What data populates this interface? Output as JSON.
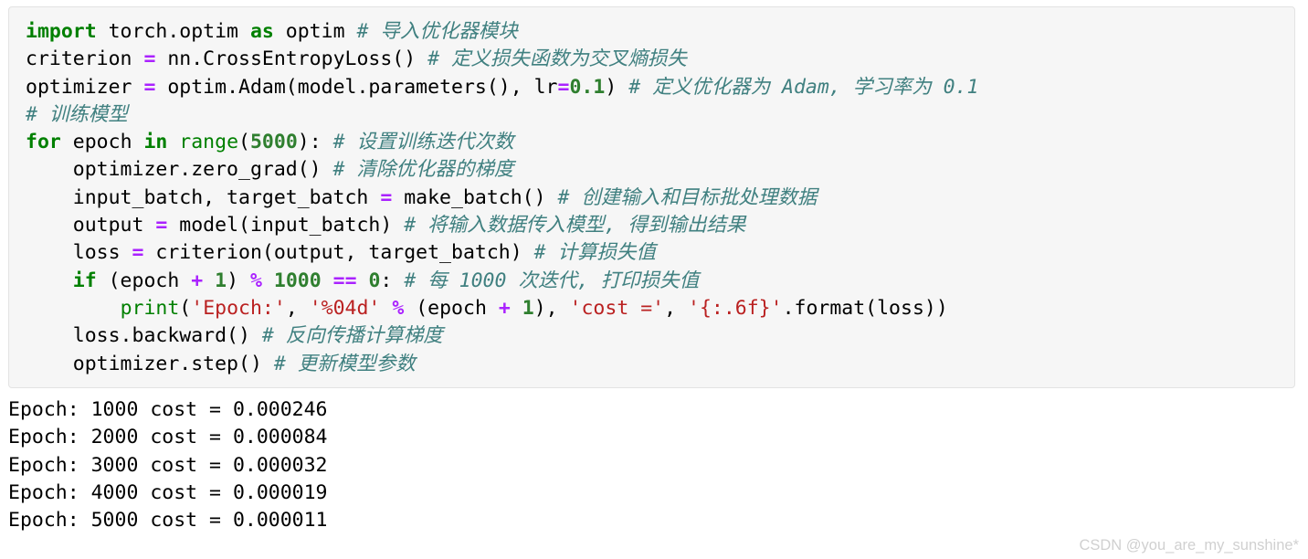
{
  "code_block": {
    "language": "python",
    "background_color": "#f6f6f6",
    "border_color": "#e3e3e3",
    "syntax_colors": {
      "keyword": "#008000",
      "builtin": "#008000",
      "number": "#2f7f2f",
      "operator": "#aa22ff",
      "string": "#ba2121",
      "comment": "#408080",
      "text": "#000000"
    },
    "lines": [
      {
        "id": "line-1",
        "tokens": [
          {
            "t": "import",
            "c": "kw"
          },
          {
            "t": " torch.optim ",
            "c": "txt"
          },
          {
            "t": "as",
            "c": "kw"
          },
          {
            "t": " optim ",
            "c": "txt"
          },
          {
            "t": "# 导入优化器模块",
            "c": "cmt"
          }
        ]
      },
      {
        "id": "line-2",
        "tokens": [
          {
            "t": "criterion ",
            "c": "txt"
          },
          {
            "t": "=",
            "c": "op"
          },
          {
            "t": " nn.CrossEntropyLoss() ",
            "c": "txt"
          },
          {
            "t": "# 定义损失函数为交叉熵损失",
            "c": "cmt"
          }
        ]
      },
      {
        "id": "line-3",
        "tokens": [
          {
            "t": "optimizer ",
            "c": "txt"
          },
          {
            "t": "=",
            "c": "op"
          },
          {
            "t": " optim.Adam(model.parameters(), lr",
            "c": "txt"
          },
          {
            "t": "=",
            "c": "op"
          },
          {
            "t": "0.1",
            "c": "num"
          },
          {
            "t": ") ",
            "c": "txt"
          },
          {
            "t": "# 定义优化器为 Adam, 学习率为 0.1",
            "c": "cmt"
          }
        ]
      },
      {
        "id": "line-4",
        "tokens": [
          {
            "t": "# 训练模型",
            "c": "cmt"
          }
        ]
      },
      {
        "id": "line-5",
        "tokens": [
          {
            "t": "for",
            "c": "kw"
          },
          {
            "t": " epoch ",
            "c": "txt"
          },
          {
            "t": "in",
            "c": "kw"
          },
          {
            "t": " ",
            "c": "txt"
          },
          {
            "t": "range",
            "c": "bi"
          },
          {
            "t": "(",
            "c": "txt"
          },
          {
            "t": "5000",
            "c": "num"
          },
          {
            "t": "): ",
            "c": "txt"
          },
          {
            "t": "# 设置训练迭代次数",
            "c": "cmt"
          }
        ]
      },
      {
        "id": "line-6",
        "tokens": [
          {
            "t": "    optimizer.zero_grad() ",
            "c": "txt"
          },
          {
            "t": "# 清除优化器的梯度",
            "c": "cmt"
          }
        ]
      },
      {
        "id": "line-7",
        "tokens": [
          {
            "t": "    input_batch, target_batch ",
            "c": "txt"
          },
          {
            "t": "=",
            "c": "op"
          },
          {
            "t": " make_batch() ",
            "c": "txt"
          },
          {
            "t": "# 创建输入和目标批处理数据",
            "c": "cmt"
          }
        ]
      },
      {
        "id": "line-8",
        "tokens": [
          {
            "t": "    output ",
            "c": "txt"
          },
          {
            "t": "=",
            "c": "op"
          },
          {
            "t": " model(input_batch) ",
            "c": "txt"
          },
          {
            "t": "# 将输入数据传入模型, 得到输出结果",
            "c": "cmt"
          }
        ]
      },
      {
        "id": "line-9",
        "tokens": [
          {
            "t": "    loss ",
            "c": "txt"
          },
          {
            "t": "=",
            "c": "op"
          },
          {
            "t": " criterion(output, target_batch) ",
            "c": "txt"
          },
          {
            "t": "# 计算损失值",
            "c": "cmt"
          }
        ]
      },
      {
        "id": "line-10",
        "tokens": [
          {
            "t": "    ",
            "c": "txt"
          },
          {
            "t": "if",
            "c": "kw"
          },
          {
            "t": " (epoch ",
            "c": "txt"
          },
          {
            "t": "+",
            "c": "op"
          },
          {
            "t": " ",
            "c": "txt"
          },
          {
            "t": "1",
            "c": "num"
          },
          {
            "t": ") ",
            "c": "txt"
          },
          {
            "t": "%",
            "c": "op"
          },
          {
            "t": " ",
            "c": "txt"
          },
          {
            "t": "1000",
            "c": "num"
          },
          {
            "t": " ",
            "c": "txt"
          },
          {
            "t": "==",
            "c": "op"
          },
          {
            "t": " ",
            "c": "txt"
          },
          {
            "t": "0",
            "c": "num"
          },
          {
            "t": ": ",
            "c": "txt"
          },
          {
            "t": "# 每 1000 次迭代, 打印损失值",
            "c": "cmt"
          }
        ]
      },
      {
        "id": "line-11",
        "tokens": [
          {
            "t": "        ",
            "c": "txt"
          },
          {
            "t": "print",
            "c": "bi"
          },
          {
            "t": "(",
            "c": "txt"
          },
          {
            "t": "'Epoch:'",
            "c": "str"
          },
          {
            "t": ", ",
            "c": "txt"
          },
          {
            "t": "'%04d'",
            "c": "str"
          },
          {
            "t": " ",
            "c": "txt"
          },
          {
            "t": "%",
            "c": "op"
          },
          {
            "t": " (epoch ",
            "c": "txt"
          },
          {
            "t": "+",
            "c": "op"
          },
          {
            "t": " ",
            "c": "txt"
          },
          {
            "t": "1",
            "c": "num"
          },
          {
            "t": "), ",
            "c": "txt"
          },
          {
            "t": "'cost ='",
            "c": "str"
          },
          {
            "t": ", ",
            "c": "txt"
          },
          {
            "t": "'{:.6f}'",
            "c": "str"
          },
          {
            "t": ".format(loss))",
            "c": "txt"
          }
        ]
      },
      {
        "id": "line-12",
        "tokens": [
          {
            "t": "    loss.backward() ",
            "c": "txt"
          },
          {
            "t": "# 反向传播计算梯度",
            "c": "cmt"
          }
        ]
      },
      {
        "id": "line-13",
        "tokens": [
          {
            "t": "    optimizer.step() ",
            "c": "txt"
          },
          {
            "t": "# 更新模型参数",
            "c": "cmt"
          }
        ]
      }
    ]
  },
  "output": {
    "lines": [
      "Epoch: 1000 cost = 0.000246",
      "Epoch: 2000 cost = 0.000084",
      "Epoch: 3000 cost = 0.000032",
      "Epoch: 4000 cost = 0.000019",
      "Epoch: 5000 cost = 0.000011"
    ]
  },
  "watermark": {
    "text": "CSDN @you_are_my_sunshine*",
    "color": "#d0d0d0"
  }
}
